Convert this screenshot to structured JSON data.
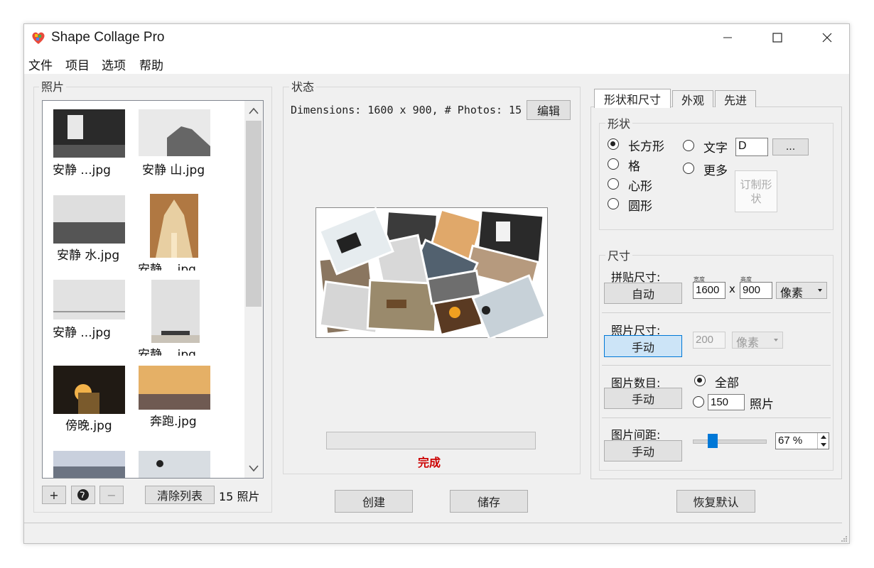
{
  "window": {
    "title": "Shape Collage Pro"
  },
  "menu": [
    "文件",
    "项目",
    "选项",
    "帮助"
  ],
  "photos_panel": {
    "label": "照片",
    "items": [
      {
        "name": "安静 ...jpg"
      },
      {
        "name": "安静 山.jpg"
      },
      {
        "name": "安静 水.jpg"
      },
      {
        "name": "安静 ...jpg"
      },
      {
        "name": "安静 ...jpg"
      },
      {
        "name": "安静 ...jpg"
      },
      {
        "name": "傍晚.jpg"
      },
      {
        "name": "奔跑.jpg"
      }
    ],
    "add_label": "+",
    "remove_label": "−",
    "clear_label": "清除列表",
    "count_text": "15  照片"
  },
  "status_panel": {
    "label": "状态",
    "dimensions_text": "Dimensions: 1600 x 900, # Photos: 15",
    "edit_label": "编辑",
    "progress": 0,
    "status_text": "完成"
  },
  "tabs": [
    "形状和尺寸",
    "外观",
    "先进"
  ],
  "shape": {
    "label": "形状",
    "options": [
      "长方形",
      "格",
      "心形",
      "圆形"
    ],
    "text_option": "文字",
    "text_value": "D",
    "more_option": "更多",
    "browse_label": "...",
    "custom_label": "订制形状"
  },
  "size": {
    "label": "尺寸",
    "collage_size_label": "拼贴尺寸:",
    "auto_label": "自动",
    "width_caption": "宽度",
    "height_caption": "高度",
    "width_value": "1600",
    "height_value": "900",
    "x_sep": "x",
    "unit": "像素",
    "photo_size_label": "照片尺寸:",
    "manual_label": "手动",
    "photo_size_value": "200",
    "photo_unit": "像素",
    "photo_count_label": "图片数目:",
    "all_option": "全部",
    "count_value": "150",
    "count_unit": "照片",
    "spacing_label": "图片间距:",
    "spacing_value": "67 %",
    "spacing_percent": 67
  },
  "bottom": {
    "create_label": "创建",
    "save_label": "储存",
    "reset_label": "恢复默认"
  },
  "colors": {
    "accent": "#0078d7",
    "status": "#cc0000"
  }
}
